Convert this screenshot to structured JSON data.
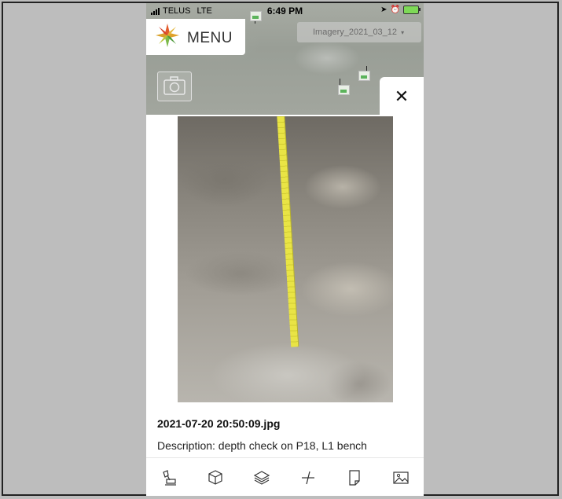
{
  "status_bar": {
    "carrier": "TELUS",
    "network": "LTE",
    "time": "6:49 PM"
  },
  "header": {
    "menu_label": "MENU",
    "imagery_select": "Imagery_2021_03_12"
  },
  "photo": {
    "filename": "2021-07-20 20:50:09.jpg",
    "description": "Description: depth check on P18, L1 bench"
  },
  "icons": {
    "close": "close-icon",
    "camera": "camera-icon",
    "toolbar": [
      "excavator-icon",
      "cube-icon",
      "layers-icon",
      "measure-icon",
      "note-icon",
      "image-icon"
    ]
  },
  "colors": {
    "battery": "#7ed957",
    "tape": "#e9e445",
    "marker": "#5bb35b"
  }
}
